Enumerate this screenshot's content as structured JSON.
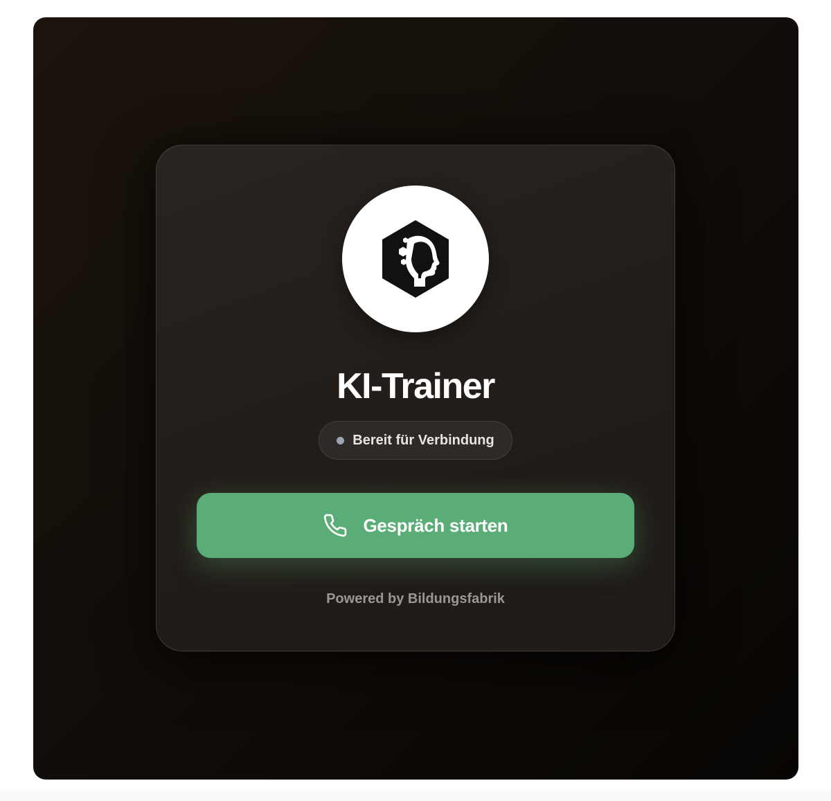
{
  "app": {
    "title": "KI-Trainer",
    "logo_icon": "ai-head-hexagon-icon"
  },
  "status": {
    "label": "Bereit für Verbindung",
    "dot_color": "#9aa6b8"
  },
  "call_button": {
    "label": "Gespräch starten",
    "icon": "phone-icon",
    "color": "#5aad76"
  },
  "footer": {
    "text": "Powered by Bildungsfabrik"
  }
}
